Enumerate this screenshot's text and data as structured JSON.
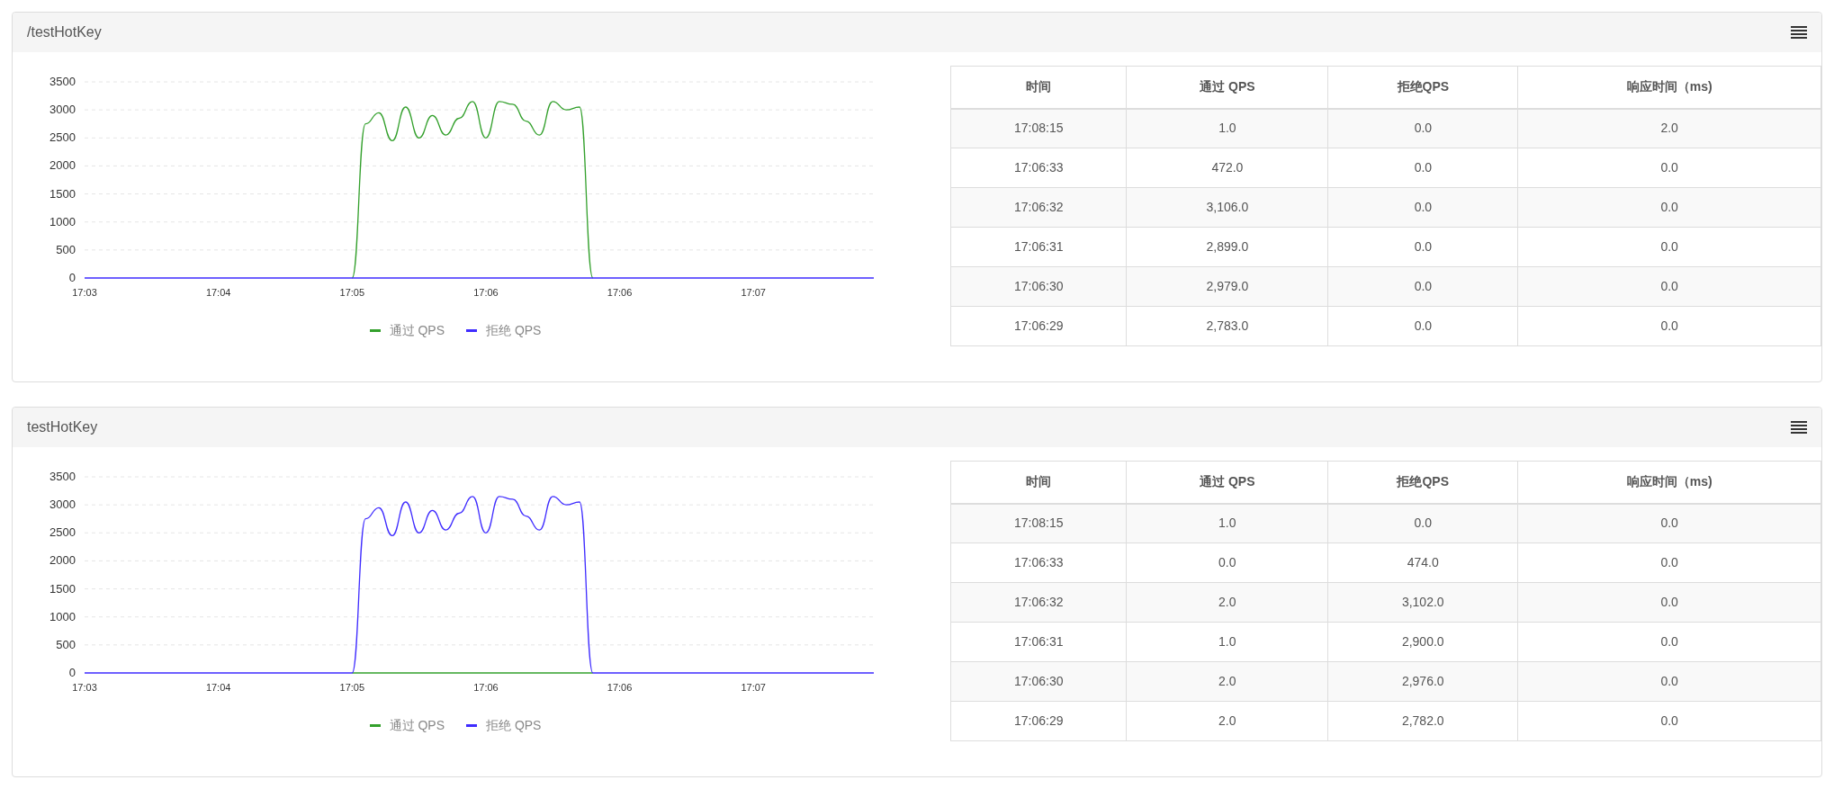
{
  "panels": [
    {
      "title": "/testHotKey",
      "chart_data": {
        "type": "line",
        "categories": [
          "17:03",
          null,
          null,
          null,
          null,
          null,
          null,
          null,
          null,
          null,
          "17:04",
          null,
          null,
          null,
          null,
          null,
          null,
          null,
          null,
          null,
          "17:05",
          null,
          null,
          null,
          null,
          null,
          null,
          null,
          null,
          null,
          "17:06",
          null,
          null,
          null,
          null,
          null,
          null,
          null,
          null,
          null,
          "17:06",
          null,
          null,
          null,
          null,
          null,
          null,
          null,
          null,
          null,
          "17:07",
          null,
          null,
          null,
          null,
          null,
          null,
          null,
          null,
          null
        ],
        "series": [
          {
            "name": "通过 QPS",
            "color": "#33a02c",
            "values": [
              null,
              null,
              null,
              null,
              null,
              null,
              null,
              null,
              null,
              null,
              null,
              null,
              null,
              null,
              null,
              null,
              null,
              null,
              null,
              null,
              0,
              2750,
              2950,
              2450,
              3050,
              2500,
              2900,
              2550,
              2850,
              3150,
              2500,
              3150,
              3100,
              2800,
              2550,
              3150,
              3000,
              3050,
              0,
              null,
              null,
              null,
              null,
              null,
              null,
              null,
              null,
              null,
              null,
              null,
              null,
              null,
              null,
              null,
              null,
              null,
              null,
              null,
              null,
              null
            ]
          },
          {
            "name": "拒绝 QPS",
            "color": "#3f2cff",
            "values": [
              0,
              0,
              0,
              0,
              0,
              0,
              0,
              0,
              0,
              0,
              0,
              0,
              0,
              0,
              0,
              0,
              0,
              0,
              0,
              0,
              0,
              0,
              0,
              0,
              0,
              0,
              0,
              0,
              0,
              0,
              0,
              0,
              0,
              0,
              0,
              0,
              0,
              0,
              0,
              0,
              0,
              0,
              0,
              0,
              0,
              0,
              0,
              0,
              0,
              0,
              0,
              0,
              0,
              0,
              0,
              0,
              0,
              0,
              0,
              0
            ]
          }
        ],
        "ylim": [
          0,
          3500
        ],
        "yticks": [
          0,
          500,
          1000,
          1500,
          2000,
          2500,
          3000,
          3500
        ],
        "grid": true,
        "legend": true
      },
      "table": {
        "columns": [
          "时间",
          "通过 QPS",
          "拒绝QPS",
          "响应时间（ms)"
        ],
        "rows": [
          [
            "17:08:15",
            "1.0",
            "0.0",
            "2.0"
          ],
          [
            "17:06:33",
            "472.0",
            "0.0",
            "0.0"
          ],
          [
            "17:06:32",
            "3,106.0",
            "0.0",
            "0.0"
          ],
          [
            "17:06:31",
            "2,899.0",
            "0.0",
            "0.0"
          ],
          [
            "17:06:30",
            "2,979.0",
            "0.0",
            "0.0"
          ],
          [
            "17:06:29",
            "2,783.0",
            "0.0",
            "0.0"
          ]
        ]
      }
    },
    {
      "title": "testHotKey",
      "chart_data": {
        "type": "line",
        "categories": [
          "17:03",
          null,
          null,
          null,
          null,
          null,
          null,
          null,
          null,
          null,
          "17:04",
          null,
          null,
          null,
          null,
          null,
          null,
          null,
          null,
          null,
          "17:05",
          null,
          null,
          null,
          null,
          null,
          null,
          null,
          null,
          null,
          "17:06",
          null,
          null,
          null,
          null,
          null,
          null,
          null,
          null,
          null,
          "17:06",
          null,
          null,
          null,
          null,
          null,
          null,
          null,
          null,
          null,
          "17:07",
          null,
          null,
          null,
          null,
          null,
          null,
          null,
          null,
          null
        ],
        "series": [
          {
            "name": "通过 QPS",
            "color": "#33a02c",
            "values": [
              null,
              null,
              null,
              null,
              null,
              null,
              null,
              null,
              null,
              null,
              null,
              null,
              null,
              null,
              null,
              null,
              null,
              null,
              null,
              null,
              0,
              0,
              0,
              0,
              0,
              0,
              0,
              0,
              0,
              0,
              0,
              0,
              0,
              0,
              0,
              0,
              0,
              0,
              0,
              null,
              null,
              null,
              null,
              null,
              null,
              null,
              null,
              null,
              null,
              null,
              null,
              null,
              null,
              null,
              null,
              null,
              null,
              null,
              null,
              null
            ]
          },
          {
            "name": "拒绝 QPS",
            "color": "#3f2cff",
            "values": [
              0,
              0,
              0,
              0,
              0,
              0,
              0,
              0,
              0,
              0,
              0,
              0,
              0,
              0,
              0,
              0,
              0,
              0,
              0,
              0,
              0,
              2750,
              2950,
              2450,
              3050,
              2500,
              2900,
              2550,
              2850,
              3150,
              2500,
              3150,
              3100,
              2800,
              2550,
              3150,
              3000,
              3050,
              0,
              0,
              0,
              0,
              0,
              0,
              0,
              0,
              0,
              0,
              0,
              0,
              0,
              0,
              0,
              0,
              0,
              0,
              0,
              0,
              0,
              0
            ]
          }
        ],
        "ylim": [
          0,
          3500
        ],
        "yticks": [
          0,
          500,
          1000,
          1500,
          2000,
          2500,
          3000,
          3500
        ],
        "grid": true,
        "legend": true
      },
      "table": {
        "columns": [
          "时间",
          "通过 QPS",
          "拒绝QPS",
          "响应时间（ms)"
        ],
        "rows": [
          [
            "17:08:15",
            "1.0",
            "0.0",
            "0.0"
          ],
          [
            "17:06:33",
            "0.0",
            "474.0",
            "0.0"
          ],
          [
            "17:06:32",
            "2.0",
            "3,102.0",
            "0.0"
          ],
          [
            "17:06:31",
            "1.0",
            "2,900.0",
            "0.0"
          ],
          [
            "17:06:30",
            "2.0",
            "2,976.0",
            "0.0"
          ],
          [
            "17:06:29",
            "2.0",
            "2,782.0",
            "0.0"
          ]
        ]
      }
    }
  ]
}
